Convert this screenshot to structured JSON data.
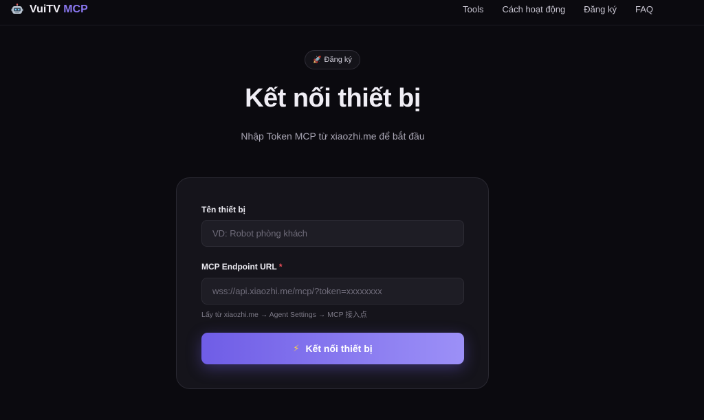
{
  "nav": {
    "brand_main": "VuiTV",
    "brand_accent": "MCP",
    "links": [
      "Tools",
      "Cách hoạt động",
      "Đăng ký",
      "FAQ"
    ]
  },
  "hero": {
    "pill_icon": "🚀",
    "pill_label": "Đăng ký",
    "title": "Kết nối thiết bị",
    "subtitle": "Nhập Token MCP từ xiaozhi.me để bắt đầu"
  },
  "form": {
    "device_name": {
      "label": "Tên thiết bị",
      "placeholder": "VD: Robot phòng khách",
      "value": ""
    },
    "endpoint": {
      "label": "MCP Endpoint URL",
      "required_mark": "*",
      "placeholder": "wss://api.xiaozhi.me/mcp/?token=xxxxxxxx",
      "value": "",
      "hint": "Lấy từ xiaozhi.me → Agent Settings → MCP 接入点"
    },
    "submit": {
      "icon": "⚡",
      "label": "Kết nối thiết bị"
    }
  },
  "colors": {
    "background": "#0b0a0f",
    "accent": "#8b78f2",
    "button_gradient_start": "#6f5de6",
    "button_gradient_end": "#9c90f7",
    "required": "#ef4f5a"
  }
}
